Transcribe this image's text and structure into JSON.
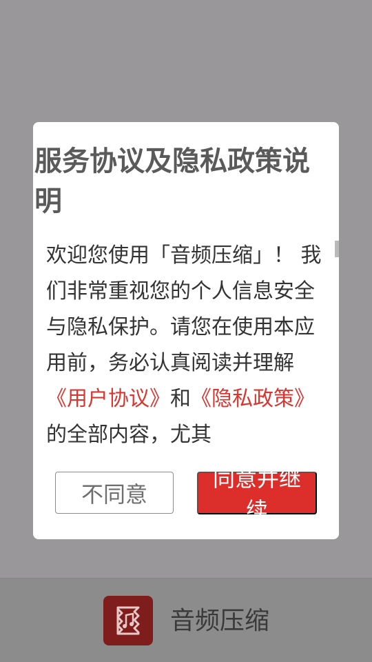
{
  "dialog": {
    "title": "服务协议及隐私政策说明",
    "body": {
      "intro": "欢迎您使用「音频压缩」！ 我们非常重视您的个人信息安全与隐私保护。请您在使用本应用前，务必认真阅读并理解",
      "user_agreement_link": "《用户协议》",
      "and": "和",
      "privacy_policy_link": "《隐私政策》",
      "tail": "的全部内容，尤其"
    },
    "disagree_button": "不同意",
    "agree_button": "同意并继续"
  },
  "bottom_bar": {
    "app_icon": "audio-file-icon",
    "app_name": "音频压缩"
  },
  "colors": {
    "accent": "#dc2f2b",
    "link": "#d93630",
    "icon_bg": "#7f1d1d"
  }
}
